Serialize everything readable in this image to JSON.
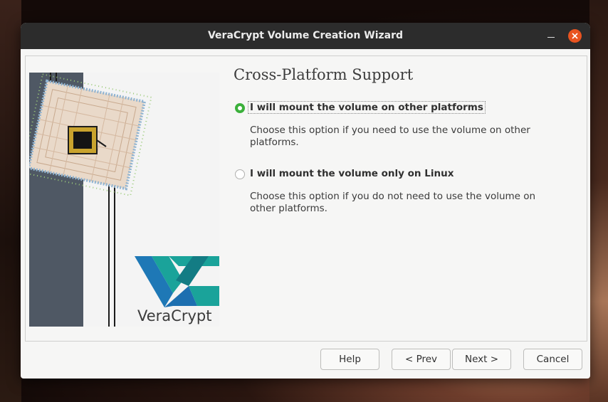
{
  "window": {
    "title": "VeraCrypt Volume Creation Wizard"
  },
  "page": {
    "heading": "Cross-Platform Support",
    "options": [
      {
        "label": "I will mount the volume on other platforms",
        "description_line1": "Choose this option if you need to use the volume on other",
        "description_line2": "platforms.",
        "selected": true
      },
      {
        "label": "I will mount the volume only on Linux",
        "description_line1": "Choose this option if you do not need to use the volume on",
        "description_line2": "other platforms.",
        "selected": false
      }
    ]
  },
  "buttons": {
    "help": "Help",
    "prev": "< Prev",
    "next": "Next >",
    "cancel": "Cancel"
  },
  "logo": {
    "text": "VeraCrypt"
  },
  "colors": {
    "title_bar": "#2c2c2c",
    "close_button": "#e95420",
    "radio_selected": "#3bb03b",
    "logo_teal": "#1aa39a",
    "logo_blue": "#1d6fb0"
  },
  "icons": {
    "minimize": "minimize-icon",
    "close": "close-icon"
  }
}
